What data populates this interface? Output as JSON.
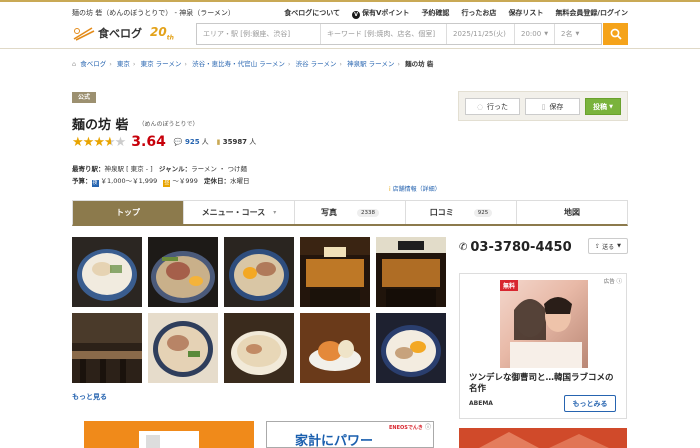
{
  "topbar": {
    "title": "麺の坊 砦（めんのぼうとりで） - 神泉（ラーメン）",
    "links": [
      "食べログについて",
      "保有Vポイント",
      "予約確認",
      "行ったお店",
      "保存リスト",
      "無料会員登録/ログイン"
    ],
    "vpoint_icon": "V"
  },
  "header": {
    "logo_text": "食べログ",
    "anniversary": "20",
    "anniversary_suffix": "th",
    "search_area_placeholder": "エリア・駅 [例:銀座、渋谷]",
    "search_keyword_placeholder": "キーワード [例:焼肉、店名、個室]",
    "date": "2025/11/25(火)",
    "time": "20:00",
    "people": "2名"
  },
  "breadcrumb": {
    "items": [
      "食べログ",
      "東京",
      "東京 ラーメン",
      "渋谷・恵比寿・代官山 ラーメン",
      "渋谷 ラーメン",
      "神泉駅 ラーメン"
    ],
    "current": "麺の坊 砦"
  },
  "shop": {
    "badge": "公式",
    "name": "麺の坊 砦",
    "ruby": "（めんのぼうとりで）",
    "score": "3.64",
    "rating": 3.64,
    "reviews": "925",
    "reviews_unit": "人",
    "saves": "35987",
    "saves_unit": "人",
    "station_label": "最寄り駅：",
    "station": "神泉駅",
    "station_extra": "[ 東京 - ]",
    "genre_label": "ジャンル：",
    "genres": "ラーメン ・ つけ麺",
    "budget_label": "予算：",
    "dinner_icon": "夜",
    "dinner_budget": "￥1,000～￥1,999",
    "lunch_icon": "昼",
    "lunch_budget": "～￥999",
    "holiday_label": "定休日：",
    "holiday": "水曜日",
    "shopinfo_link": "店舗情報（詳細）"
  },
  "actions": {
    "went": "行った",
    "save": "保存",
    "post": "投稿"
  },
  "tabs": [
    {
      "label": "トップ",
      "count": ""
    },
    {
      "label": "メニュー・コース",
      "count": ""
    },
    {
      "label": "写真",
      "count": "2338"
    },
    {
      "label": "口コミ",
      "count": "925"
    },
    {
      "label": "地図",
      "count": ""
    }
  ],
  "photos": {
    "more": "もっと見る"
  },
  "contact": {
    "phone": "03-3780-4450",
    "send": "送る"
  },
  "ad": {
    "label": "広告",
    "free": "無料",
    "headline": "ツンデレな御曹司と…韓国ラブコメの名作",
    "brand": "ABEMA",
    "cta": "もっとみる"
  },
  "bottom_ads": {
    "ad2_text": "家計にパワー",
    "ad2_brand": "ENEOSでんき"
  },
  "colors": {
    "accent_gold": "#8c7a4c",
    "score_red": "#c7000a",
    "link_blue": "#2664b0",
    "post_green": "#7ab33c",
    "search_orange": "#f5a31a"
  }
}
